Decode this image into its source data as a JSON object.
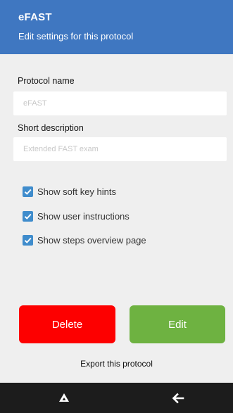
{
  "header": {
    "title": "eFAST",
    "subtitle": "Edit settings for this protocol"
  },
  "form": {
    "name_label": "Protocol name",
    "name_value": "eFAST",
    "description_label": "Short description",
    "description_value": "Extended FAST exam"
  },
  "options": [
    {
      "label": "Show soft key hints",
      "checked": true
    },
    {
      "label": "Show user instructions",
      "checked": true
    },
    {
      "label": "Show steps overview page",
      "checked": true
    }
  ],
  "actions": {
    "delete_label": "Delete",
    "edit_label": "Edit",
    "export_label": "Export this protocol"
  },
  "navbar": {
    "home_icon": "triangle-home-icon",
    "back_icon": "back-arrow-icon"
  },
  "colors": {
    "header": "#3f77c1",
    "delete": "#fd0000",
    "edit": "#6eb241",
    "checkbox": "#3f8ccc",
    "navbar": "#1c1c1c"
  }
}
